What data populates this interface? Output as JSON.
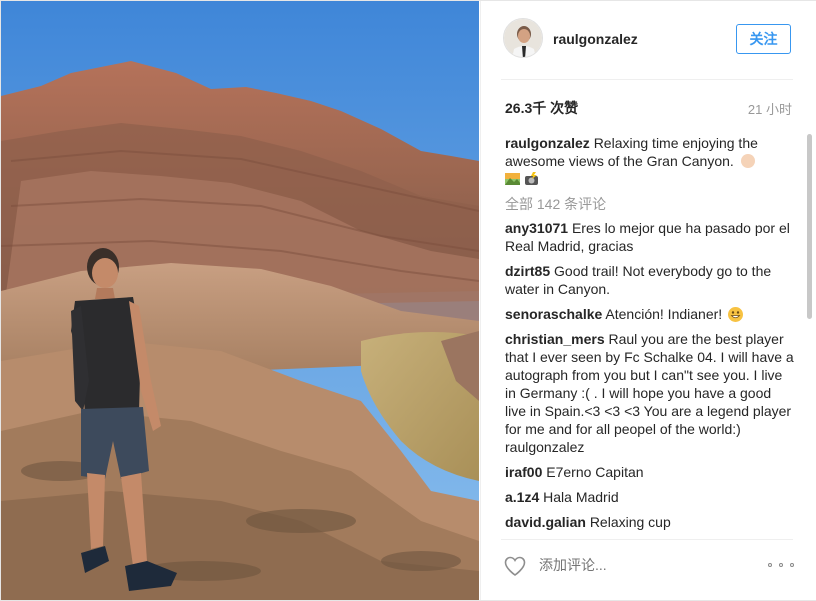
{
  "post": {
    "username": "raulgonzalez",
    "follow_label": "关注",
    "likes": "26.3千 次赞",
    "time_ago": "21 小时",
    "caption": {
      "user": "raulgonzalez",
      "text": "Relaxing time enjoying the awesome views of the Gran Canyon."
    },
    "view_all_comments": "全部 142 条评论",
    "comments": [
      {
        "user": "any31071",
        "text": "Eres lo mejor que ha pasado por el Real Madrid, gracias"
      },
      {
        "user": "dzirt85",
        "text": "Good trail! Not everybody go to the water in Canyon."
      },
      {
        "user": "senoraschalke",
        "text": "Atención! Indianer!"
      },
      {
        "user": "christian_mers",
        "text": "Raul you are the best player that I ever seen by Fc Schalke 04. I will have a autograph from you but I can\"t see you. I live in Germany :( . I will hope you have a good live in Spain.<3 <3 <3 You are a legend player for me and for all peopel of the world:) raulgonzalez"
      },
      {
        "user": "iraf00",
        "text": "E7erno Capitan"
      },
      {
        "user": "a.1z4",
        "text": "Hala Madrid"
      },
      {
        "user": "david.galian",
        "text": "Relaxing cup"
      }
    ],
    "add_comment_placeholder": "添加评论...",
    "icons": {
      "like": "heart-icon",
      "more": "more-options-icon",
      "caption_emoji_1": "ok-hand-emoji-icon",
      "caption_emoji_2": "landscape-emoji-icon",
      "caption_emoji_3": "camera-flash-emoji-icon",
      "comment_emoji": "grinning-emoji-icon"
    },
    "colors": {
      "accent": "#3897f0",
      "muted": "#999999",
      "text": "#262626"
    }
  }
}
